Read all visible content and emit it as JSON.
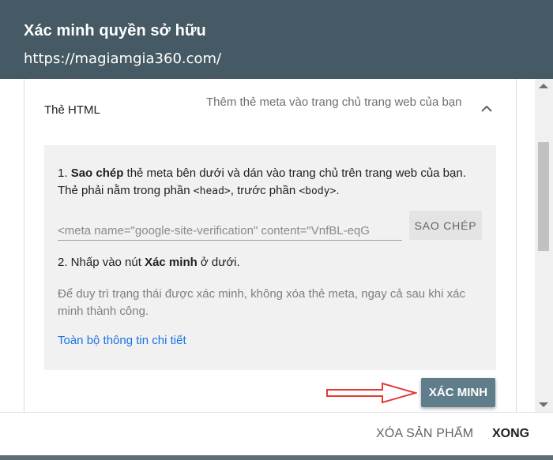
{
  "dialog": {
    "title": "Xác minh quyền sở hữu",
    "url": "https://magiamgia360.com/"
  },
  "method": {
    "name": "Thẻ HTML",
    "description": "Thêm thẻ meta vào trang chủ trang web của bạn"
  },
  "steps": {
    "step1_num": "1. ",
    "step1_bold": "Sao chép",
    "step1_text": " thẻ meta bên dưới và dán vào trang chủ trên trang web của bạn. Thẻ phải nằm trong phần ",
    "step1_head": "<head>",
    "step1_mid": ", trước phần ",
    "step1_body": "<body>",
    "step1_end": ".",
    "meta_value": "<meta name=\"google-site-verification\" content=\"VnfBL-eqG",
    "copy_label": "SAO CHÉP",
    "step2_text": "2. Nhấp vào nút ",
    "step2_bold": "Xác minh",
    "step2_end": " ở dưới.",
    "note": "Để duy trì trạng thái được xác minh, không xóa thẻ meta, ngay cả sau khi xác minh thành công.",
    "details_link": "Toàn bộ thông tin chi tiết"
  },
  "verify_label": "XÁC MINH",
  "footer": {
    "remove_label": "XÓA SẢN PHẨM",
    "close_label": "XONG"
  },
  "icons": {
    "chevron": "chevron-up-icon",
    "arrow": "arrow-right-icon"
  },
  "colors": {
    "header_bg": "#455a64",
    "verify_bg": "#607d8b",
    "link": "#1a73e8",
    "arrow": "#e53935"
  }
}
